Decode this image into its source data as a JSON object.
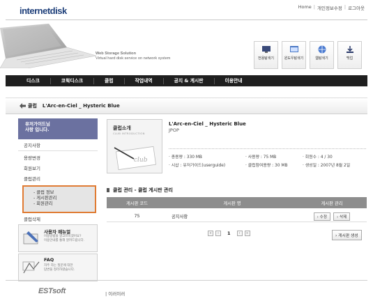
{
  "header": {
    "logo_part1": "internet",
    "logo_part2": "disk",
    "links": [
      "Home",
      "개인정보수정",
      "로그아웃"
    ],
    "tagline1": "Web Storage Solution",
    "tagline2": "Virtual hard disk service on network system",
    "quick_buttons": [
      "전용탐색기",
      "윈도우탐색기",
      "웹탐색기",
      "백업"
    ]
  },
  "nav": [
    "디스크",
    "코웍디스크",
    "클럽",
    "작업내역",
    "공지 & 게시판",
    "이용안내"
  ],
  "breadcrumb": {
    "section": "클럽",
    "club": "L'Arc-en-Ciel _ Hysteric Blue"
  },
  "sidebar": {
    "user_line1": "유저가이드님",
    "user_line2": "사랑 입니다.",
    "notice": "공지사항",
    "items": [
      "용량변경",
      "회원보기",
      "클럽관리"
    ],
    "sub_items": [
      "- 클럽 정보",
      "- 게시판관리",
      "- 회원관리"
    ],
    "delete": "클럽삭제",
    "manual_title": "사용자 매뉴얼",
    "manual_desc1": "이용방법을 알고프시겠어요?",
    "manual_desc2": "이용안내를 통해 알려드립니다.",
    "faq_title": "FAQ",
    "faq_desc1": "자주 하는 질문에 대한",
    "faq_desc2": "답변을 정리하였습니다."
  },
  "club": {
    "label": "클럽소개",
    "label_en": "CLUB INTRODUCTION",
    "name": "L'Arc-en-Ciel _ Hysteric Blue",
    "genre": "JPOP",
    "total_capacity": "· 총용량 : 330 MB",
    "used_capacity": "· 사용량 : 75 MB",
    "members": "· 회원수 : 4 / 30",
    "sysop": "· 시삽 : 유저가이드(userguide)",
    "join_capacity": "· 클럽참여용량 : 30 MB",
    "created": "· 생성일 : 2007년 8월 2일"
  },
  "board": {
    "title": "클럽 관리 - 클럽 게시판 관리",
    "columns": [
      "게시판 코드",
      "게시판 명",
      "게시판 관리"
    ],
    "rows": [
      {
        "code": "75",
        "name": "공지사항",
        "edit": "› 수정",
        "delete": "› 삭제"
      }
    ],
    "page": "1",
    "create_button": "› 게시판 생성"
  },
  "footer": {
    "brand": "ESTsoft",
    "link": "| 이러이러"
  },
  "colors": {
    "nav_bg": "#1f1f1f",
    "user_box": "#6b71a0",
    "highlight": "#e07b33",
    "table_head": "#8d8d8d"
  }
}
